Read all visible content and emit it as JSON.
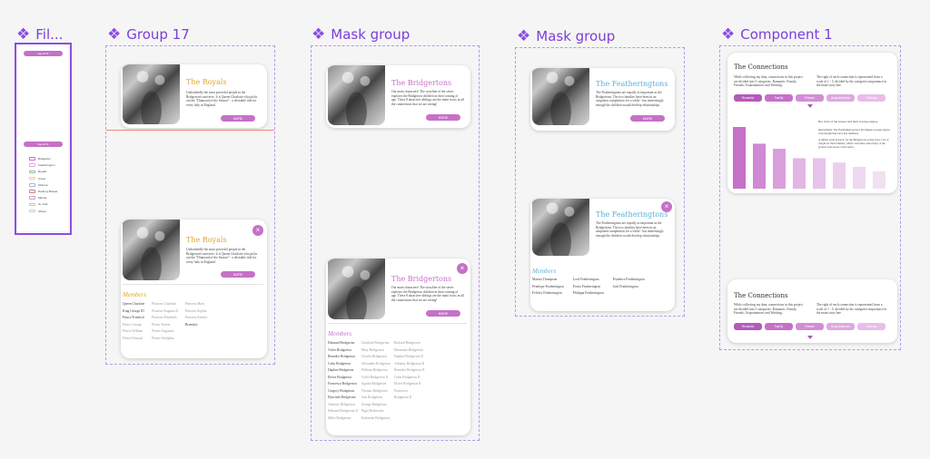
{
  "frames": {
    "filter": "Fil...",
    "group17": "Group 17",
    "mask1": "Mask group",
    "mask2": "Mask group",
    "component": "Component 1"
  },
  "diamond_icon": "❖",
  "filter_panel": {
    "pill_top": "Agend ⊗",
    "pill_mid": "Agend ⊗",
    "items": [
      {
        "label": "Bridgerton",
        "color": "#c571c8"
      },
      {
        "label": "Featherington",
        "color": "#e7a6e9"
      },
      {
        "label": "Royals",
        "color": "#8fbf8f"
      },
      {
        "label": "Crane",
        "color": "#f2cf86"
      },
      {
        "label": "Sharma",
        "color": "#9ab8e0"
      },
      {
        "label": "Danbury Basset",
        "color": "#d08080"
      },
      {
        "label": "Marina",
        "color": "#c8a0d8"
      },
      {
        "label": "St. Clair",
        "color": "#e8b3b0"
      },
      {
        "label": "Others",
        "color": "#ccc"
      }
    ]
  },
  "royals": {
    "title": "The Royals",
    "title_color": "#e6a22f",
    "body": "Undoubtedly the most powerful people in the Bridgerton's universe. It is Queen Charlotte who picks out the \"Diamond of the Season\" - a desirable title for every lady in England.",
    "button": "MORE",
    "close": "×",
    "members_title": "Members",
    "members": [
      [
        {
          "t": "Queen Charlotte",
          "d": false
        },
        {
          "t": "King George III",
          "d": false
        },
        {
          "t": "Prince Friedrich",
          "d": false
        },
        {
          "t": "Prince George",
          "d": true
        },
        {
          "t": "Prince William",
          "d": true
        },
        {
          "t": "Prince Edward",
          "d": true
        }
      ],
      [
        {
          "t": "Princess Charlotte",
          "d": true
        },
        {
          "t": "Princess Augusta II",
          "d": true
        },
        {
          "t": "Princess Elizabeth",
          "d": true
        },
        {
          "t": "Prince Ernest",
          "d": true
        },
        {
          "t": "Prince Augustus",
          "d": true
        },
        {
          "t": "Prince Adolphus",
          "d": true
        }
      ],
      [
        {
          "t": "Princess Mary",
          "d": true
        },
        {
          "t": "Princess Sophia",
          "d": true
        },
        {
          "t": "Princess Amelia",
          "d": true
        },
        {
          "t": "Brimsley",
          "d": false
        }
      ]
    ]
  },
  "bridgertons": {
    "title": "The Bridgertons",
    "title_color": "#c571c8",
    "body": "Our main characters! The storyline of the series explores the Bridgerton children in their coming of age. These 8 attractive siblings are the main focus in all the connections that we are seeing!",
    "button": "MORE",
    "close": "×",
    "members_title": "Members",
    "members": [
      [
        {
          "t": "Edmund Bridgerton",
          "d": false
        },
        {
          "t": "Violet Bridgerton",
          "d": false
        },
        {
          "t": "Benedict Bridgerton",
          "d": false
        },
        {
          "t": "Colin Bridgerton",
          "d": false
        },
        {
          "t": "Daphne Bridgerton",
          "d": false
        },
        {
          "t": "Eloise Bridgerton",
          "d": false
        },
        {
          "t": "Francesca Bridgerton",
          "d": false
        },
        {
          "t": "Gregory Bridgerton",
          "d": false
        },
        {
          "t": "Hyacinth Bridgerton",
          "d": false
        },
        {
          "t": "Anthony Bridgerton",
          "d": true
        },
        {
          "t": "Edmund Bridgerton II",
          "d": true
        },
        {
          "t": "Miles Bridgerton",
          "d": true
        }
      ],
      [
        {
          "t": "Charlotte Bridgerton",
          "d": true
        },
        {
          "t": "Mary Bridgerton",
          "d": true
        },
        {
          "t": "Charles Bridgerton",
          "d": true
        },
        {
          "t": "Alexander Bridgerton",
          "d": true
        },
        {
          "t": "William Bridgerton",
          "d": true
        },
        {
          "t": "Violet Bridgerton II",
          "d": true
        },
        {
          "t": "Agatha Bridgerton",
          "d": true
        },
        {
          "t": "Thomas Bridgerton",
          "d": true
        },
        {
          "t": "Ann Bridgerton",
          "d": true
        },
        {
          "t": "George Bridgerton",
          "d": true
        },
        {
          "t": "Nigel Berbrooke",
          "d": true
        },
        {
          "t": "Katharine Bridgerton",
          "d": true
        }
      ],
      [
        {
          "t": "Richard Bridgerton",
          "d": true
        },
        {
          "t": "Hermione Bridgerton",
          "d": true
        },
        {
          "t": "Daphne Bridgerton II",
          "d": true
        },
        {
          "t": "Anthony Bridgerton II",
          "d": true
        },
        {
          "t": "Benedict Bridgerton II",
          "d": true
        },
        {
          "t": "Colin Bridgerton II",
          "d": true
        },
        {
          "t": "Eloise Bridgerton II",
          "d": true
        },
        {
          "t": "Francesca",
          "d": true
        },
        {
          "t": "Bridgerton II",
          "d": true
        }
      ]
    ]
  },
  "featheringtons": {
    "title": "The Featheringtons",
    "title_color": "#5ab0d6",
    "body": "The Featheringtons are equally as important as the Bridgertons. The two families have been in an unspoken competition for a while - but interestingly enough the children would develop relationships.",
    "button": "MORE",
    "close": "×",
    "members_title": "Members",
    "members": [
      [
        {
          "t": "Marina Thompson",
          "d": false
        },
        {
          "t": "Penelope Featherington",
          "d": false
        },
        {
          "t": "Felicity Featherington",
          "d": false
        }
      ],
      [
        {
          "t": "Lord Featherington",
          "d": false
        },
        {
          "t": "Portia Featherington",
          "d": false
        },
        {
          "t": "Philippa Featherington",
          "d": false
        }
      ],
      [
        {
          "t": "Prudence Featherington",
          "d": false
        },
        {
          "t": "Jack Featherington",
          "d": false
        }
      ]
    ]
  },
  "connections": {
    "title": "The Connections",
    "left_text": "While collecting my data, connections in this project are divided into 5 categories: Romantic, Family, Friends, Acquaintances and Working.",
    "right_text": "The right of each connection is represented from a scale of 1 - 5, divided by the categories importance in the main story line.",
    "tabs": [
      {
        "label": "Romantic",
        "color": "#b35bb8"
      },
      {
        "label": "Family",
        "color": "#c571c8"
      },
      {
        "label": "Friends",
        "color": "#d28ed5"
      },
      {
        "label": "Acquaintances",
        "color": "#dea8e0"
      },
      {
        "label": "Working",
        "color": "#e8bde9"
      }
    ],
    "chart_note_title": "Bar chart of the houses and their average degree.",
    "chart_note_1": "Interestingly, The Featheringtons have the highest average degree, even though they have less members.",
    "chart_note_2": "A similar trend however for the Bridgertons as they have a lot of weight for their families, which could then cause many of the greatest side stories of the series."
  },
  "chart_data": {
    "type": "bar",
    "categories": [
      "",
      "",
      "",
      "",
      "",
      "",
      "",
      ""
    ],
    "values": [
      85,
      62,
      55,
      42,
      42,
      36,
      30,
      24
    ],
    "colors": [
      "#c571c8",
      "#d089d3",
      "#d9a0dc",
      "#e2b6e4",
      "#e7c3e9",
      "#ebcfec",
      "#eed8ef",
      "#f1e1f2"
    ],
    "title": "",
    "xlabel": "",
    "ylabel": "",
    "ylim": [
      0,
      100
    ]
  }
}
